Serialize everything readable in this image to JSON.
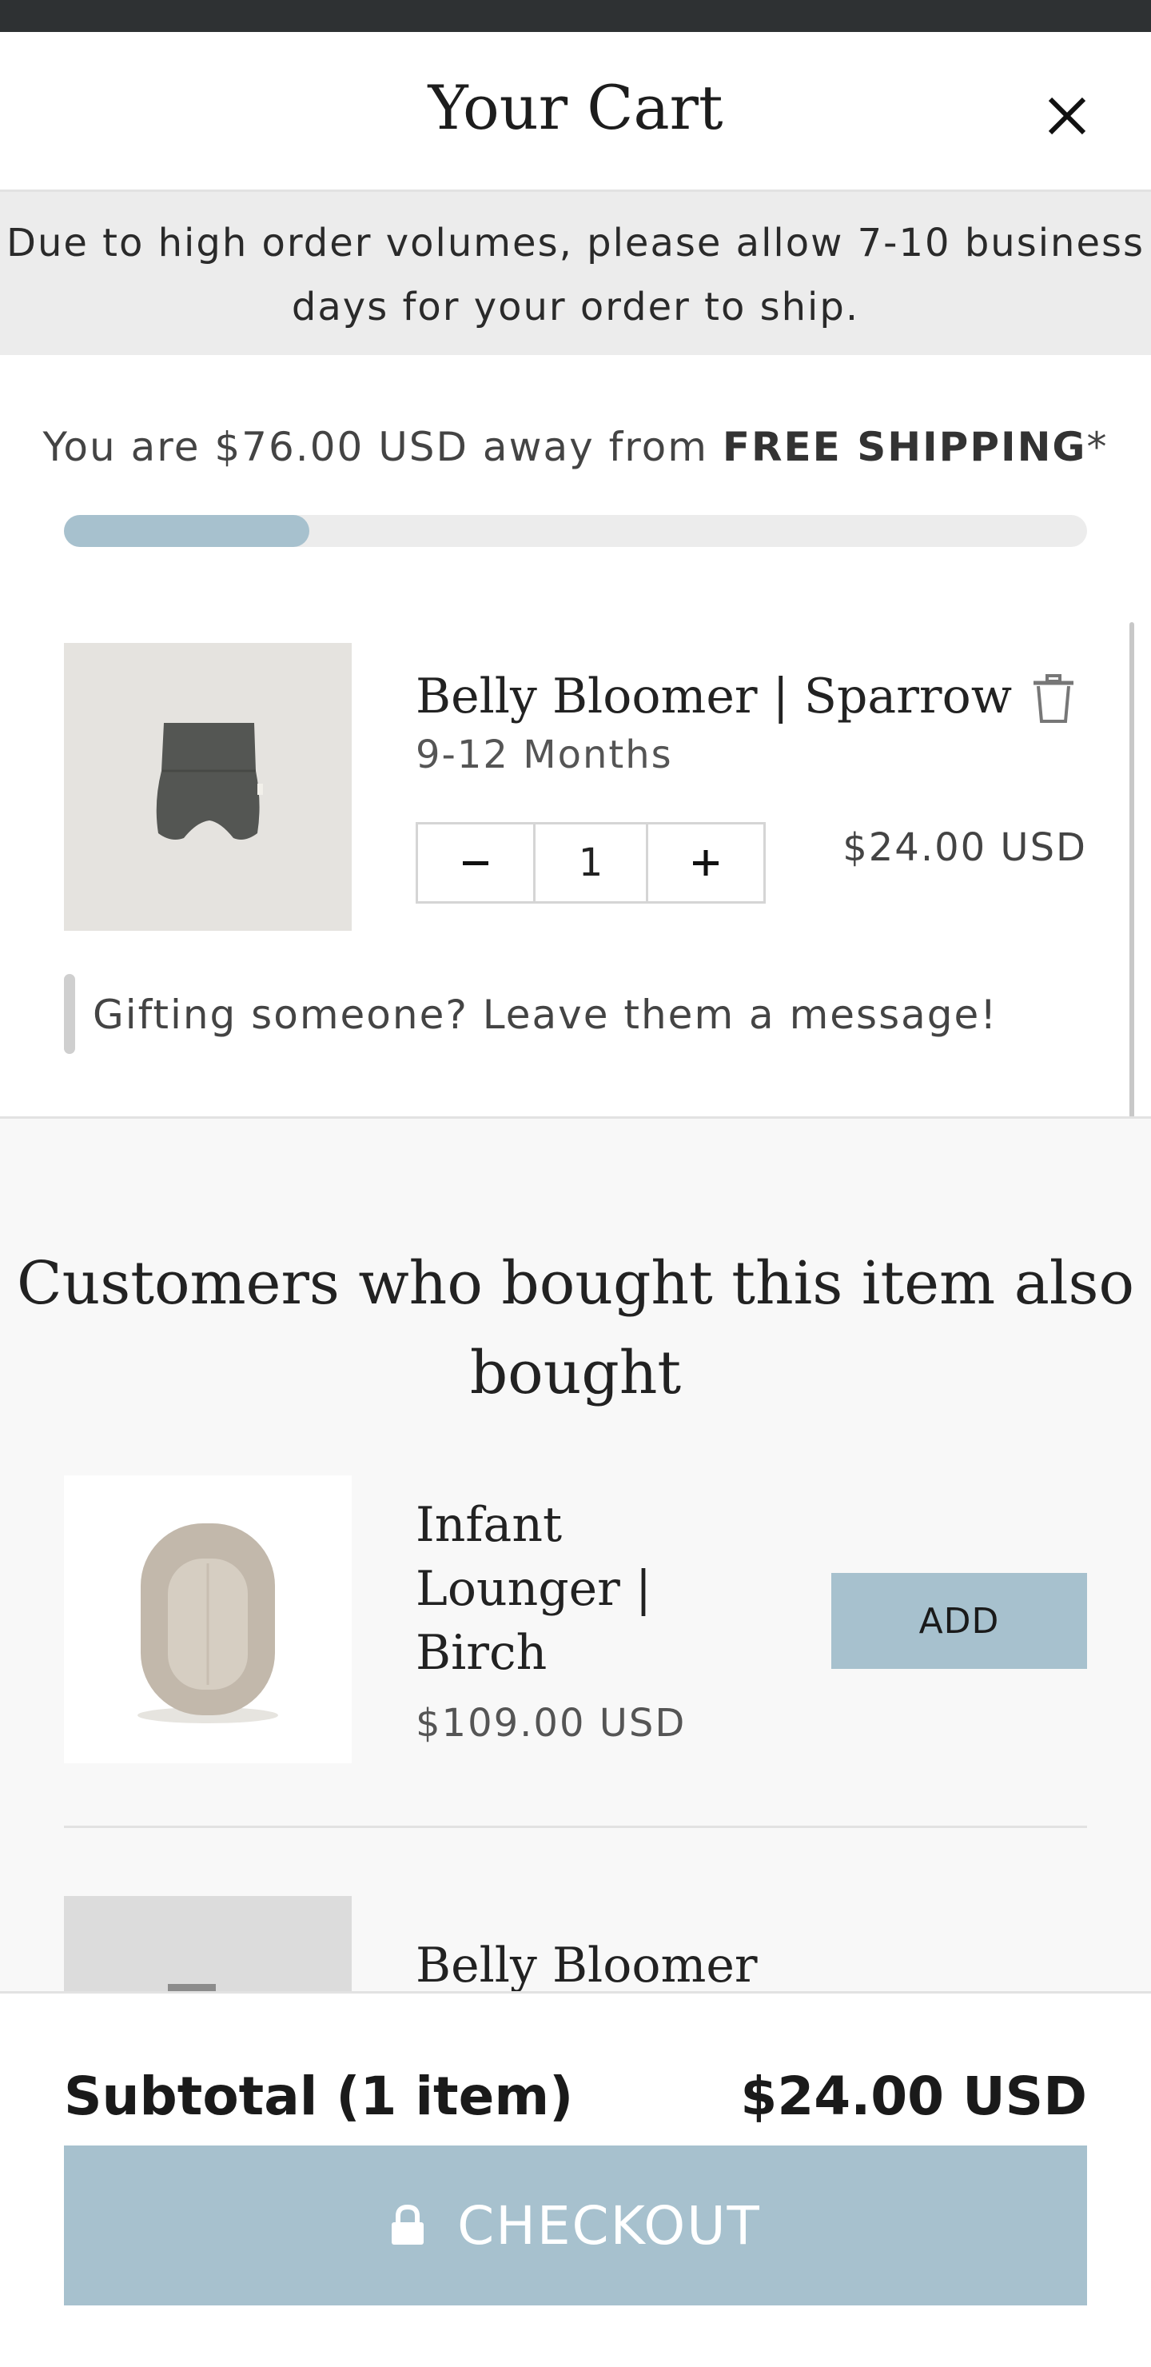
{
  "cart": {
    "title": "Your Cart",
    "notice": "Due to high order volumes, please allow 7-10 business days for your order to ship."
  },
  "shipping": {
    "prefix": "You are $76.00 USD away from ",
    "highlight": "FREE SHIPPING",
    "suffix": "*",
    "progress_fraction": 0.24,
    "bar_color": "#a7c1ce"
  },
  "line_items": [
    {
      "name": "Belly Bloomer | Sparrow",
      "variant": "9-12 Months",
      "quantity": "1",
      "price": "$24.00 USD",
      "image_icon": "dark-grey-bloomer-shorts"
    }
  ],
  "gift": {
    "prompt": "Gifting someone? Leave them a message!"
  },
  "upsell": {
    "title": "Customers who bought this item also bought",
    "items": [
      {
        "name": "Infant Lounger | Birch",
        "price": "$109.00 USD",
        "button": "ADD",
        "image_icon": "infant-lounger"
      },
      {
        "name": "Belly Bloomer",
        "image_icon": "bloomer-product"
      }
    ]
  },
  "footer": {
    "subtotal_label": "Subtotal (1 item)",
    "subtotal_value": "$24.00 USD",
    "checkout_label": "CHECKOUT",
    "accent": "#a7c1ce"
  }
}
